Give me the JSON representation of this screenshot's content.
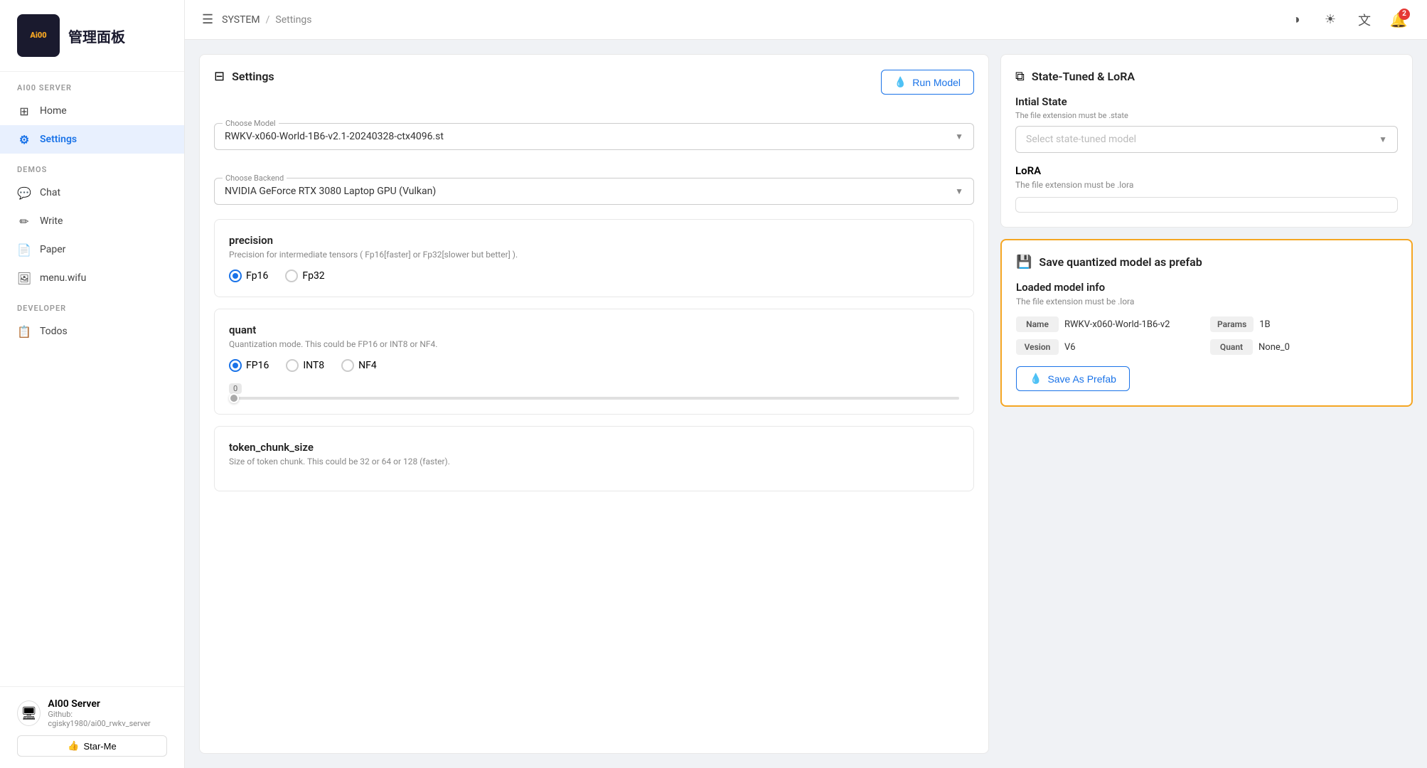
{
  "app": {
    "logo_line1": "Ai00",
    "logo_line2": "管理面板",
    "notification_count": "2"
  },
  "sidebar": {
    "server_section": "AI00 SERVER",
    "demos_section": "DEMOS",
    "developer_section": "DEVELOPER",
    "items": [
      {
        "id": "home",
        "label": "Home",
        "icon": "⊞"
      },
      {
        "id": "settings",
        "label": "Settings",
        "icon": "⚙",
        "active": true
      }
    ],
    "demos_items": [
      {
        "id": "chat",
        "label": "Chat",
        "icon": "💬"
      },
      {
        "id": "write",
        "label": "Write",
        "icon": "✏"
      },
      {
        "id": "paper",
        "label": "Paper",
        "icon": "📄"
      },
      {
        "id": "menu_wifu",
        "label": "menu.wifu",
        "icon": "🖼"
      }
    ],
    "dev_items": [
      {
        "id": "todos",
        "label": "Todos",
        "icon": "📋"
      }
    ],
    "server_card": {
      "name": "AI00 Server",
      "github_label": "Github:",
      "github_link": "cgisky1980/ai00_rwkv_server"
    },
    "star_me": "Star-Me"
  },
  "header": {
    "breadcrumb_root": "SYSTEM",
    "breadcrumb_sep": "/",
    "breadcrumb_current": "Settings"
  },
  "settings_panel": {
    "title": "Settings",
    "run_model_btn": "Run Model",
    "choose_model_label": "Choose Model",
    "chosen_model": "RWKV-x060-World-1B6-v2.1-20240328-ctx4096.st",
    "choose_backend_label": "Choose Backend",
    "chosen_backend": "NVIDIA GeForce RTX 3080 Laptop GPU (Vulkan)",
    "precision_title": "precision",
    "precision_desc": "Precision for intermediate tensors ( Fp16[faster] or Fp32[slower but better] ).",
    "precision_fp16": "Fp16",
    "precision_fp32": "Fp32",
    "precision_selected": "Fp16",
    "quant_title": "quant",
    "quant_desc": "Quantization mode. This could be FP16 or INT8 or NF4.",
    "quant_fp16": "FP16",
    "quant_int8": "INT8",
    "quant_nf4": "NF4",
    "quant_selected": "FP16",
    "slider_value": "0",
    "token_chunk_title": "token_chunk_size",
    "token_chunk_desc": "Size of token chunk. This could be 32 or 64 or 128 (faster)."
  },
  "right_panel": {
    "state_lora_title": "State-Tuned & LoRA",
    "initial_state_title": "Intial State",
    "initial_state_desc": "The file extension must be .state",
    "state_select_placeholder": "Select state-tuned model",
    "lora_title": "LoRA",
    "lora_desc": "The file extension must be .lora",
    "prefab_section_title": "Save quantized model as prefab",
    "loaded_model_title": "Loaded model info",
    "loaded_model_desc": "The file extension must be .lora",
    "name_badge": "Name",
    "name_value": "RWKV-x060-World-1B6-v2",
    "params_badge": "Params",
    "params_value": "1B",
    "version_badge": "Vesion",
    "version_value": "V6",
    "quant_badge": "Quant",
    "quant_value": "None_0",
    "save_prefab_btn": "Save As Prefab"
  }
}
